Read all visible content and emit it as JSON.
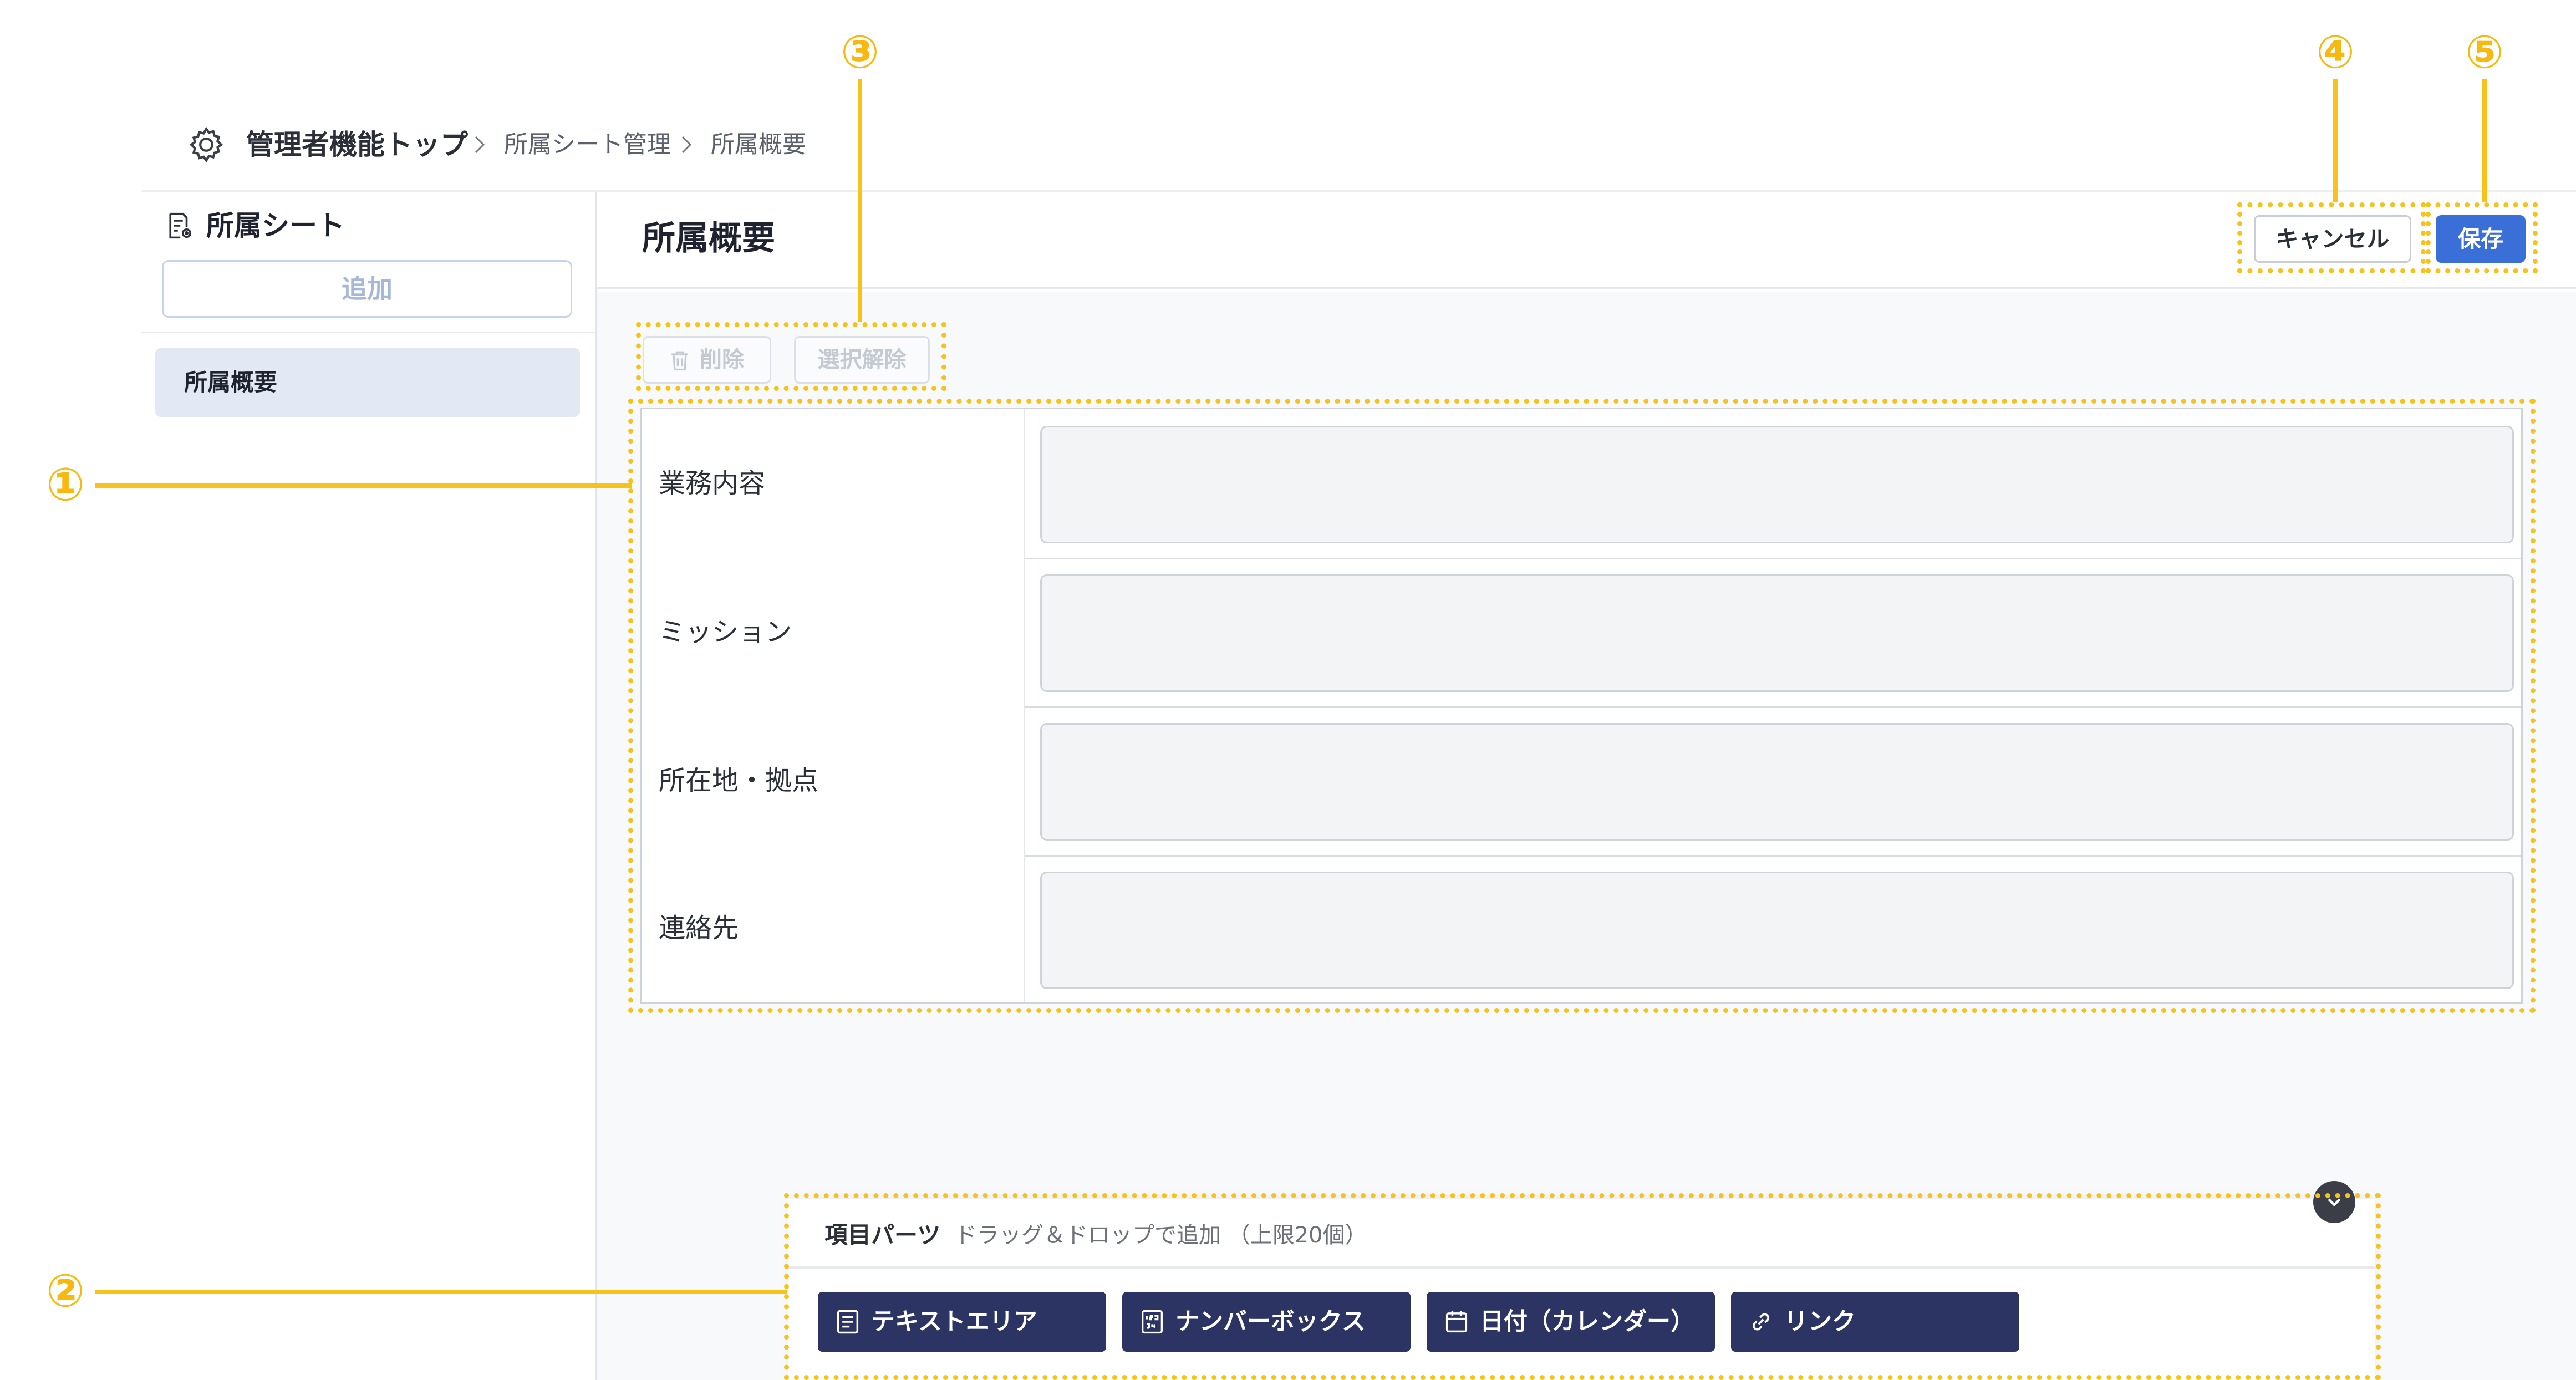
{
  "breadcrumb": {
    "root": "管理者機能トップ",
    "crumbs": [
      "所属シート管理",
      "所属概要"
    ]
  },
  "sidebar": {
    "title": "所属シート",
    "add_label": "追加",
    "items": [
      {
        "label": "所属概要",
        "selected": true
      }
    ]
  },
  "main": {
    "title": "所属概要",
    "cancel_label": "キャンセル",
    "save_label": "保存",
    "delete_label": "削除",
    "deselect_label": "選択解除"
  },
  "form": {
    "rows": [
      {
        "label": "業務内容",
        "value": ""
      },
      {
        "label": "ミッション",
        "value": ""
      },
      {
        "label": "所在地・拠点",
        "value": ""
      },
      {
        "label": "連絡先",
        "value": ""
      }
    ]
  },
  "parts": {
    "title": "項目パーツ",
    "hint": "ドラッグ＆ドロップで追加 （上限20個）",
    "items": [
      {
        "label": "テキストエリア",
        "icon": "text-area-icon"
      },
      {
        "label": "ナンバーボックス",
        "icon": "number-box-icon"
      },
      {
        "label": "日付（カレンダー）",
        "icon": "calendar-icon"
      },
      {
        "label": "リンク",
        "icon": "link-icon"
      }
    ]
  },
  "annotations": [
    "①",
    "②",
    "③",
    "④",
    "⑤"
  ],
  "colors": {
    "accent": "#3a6fd8",
    "annotation": "#f7c31a",
    "part_button": "#2b3463",
    "sidebar_selected": "#e3e8f5"
  }
}
